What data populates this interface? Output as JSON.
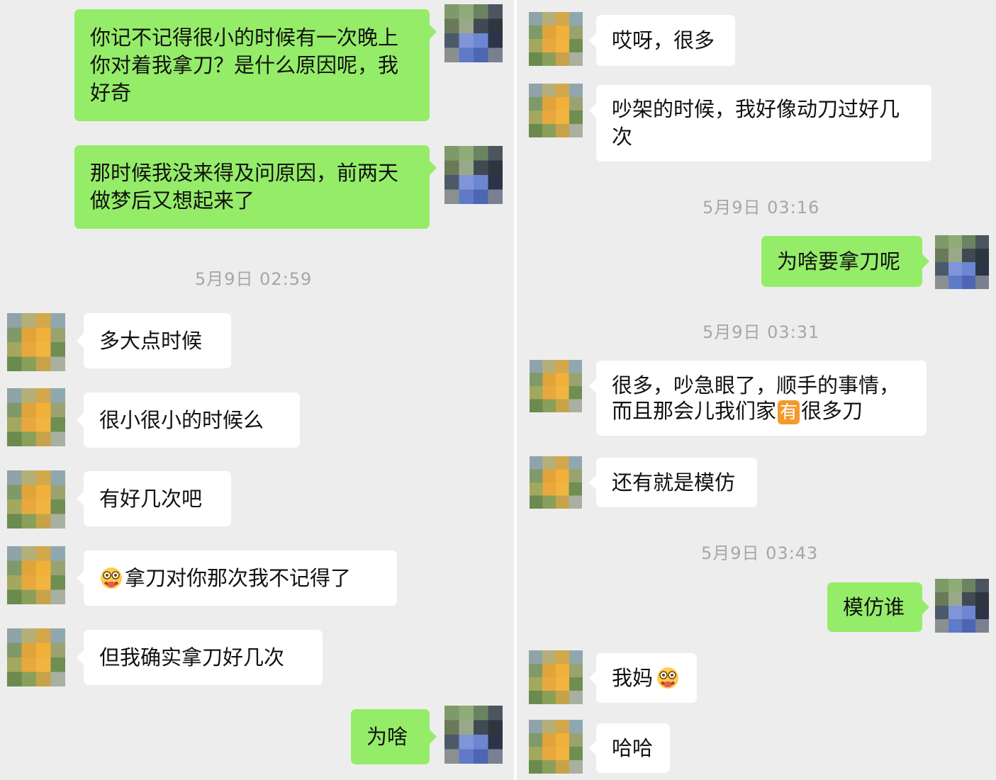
{
  "left": {
    "msg_1": "你记不记得很小的时候有一次晚上你对着我拿刀？是什么原因呢，我好奇",
    "msg_2": "那时候我没来得及问原因，前两天做梦后又想起来了",
    "time_1": "5月9日 02:59",
    "msg_3": "多大点时候",
    "msg_4": "很小很小的时候么",
    "msg_5": "有好几次吧",
    "msg_6": "拿刀对你那次我不记得了",
    "msg_7": "但我确实拿刀好几次",
    "msg_8": "为啥"
  },
  "right": {
    "msg_1": "哎呀，很多",
    "msg_2": "吵架的时候，我好像动刀过好几次",
    "time_1": "5月9日 03:16",
    "msg_3": "为啥要拿刀呢",
    "time_2": "5月9日 03:31",
    "msg_4_line1": "很多，吵急眼了，顺手的事情，",
    "msg_4_line2_a": "而且那会儿我们家",
    "msg_4_badge": "有",
    "msg_4_line2_b": "很多刀",
    "msg_5": "还有就是模仿",
    "time_2b": "5月9日 03:43",
    "msg_6": "模仿谁",
    "msg_7": "我妈",
    "msg_8": "哈哈"
  },
  "icons": {
    "emoji": "facepalm-emoji",
    "sender_avatar": "pixelated-avatar-blue",
    "receiver_avatar": "pixelated-avatar-orange"
  }
}
